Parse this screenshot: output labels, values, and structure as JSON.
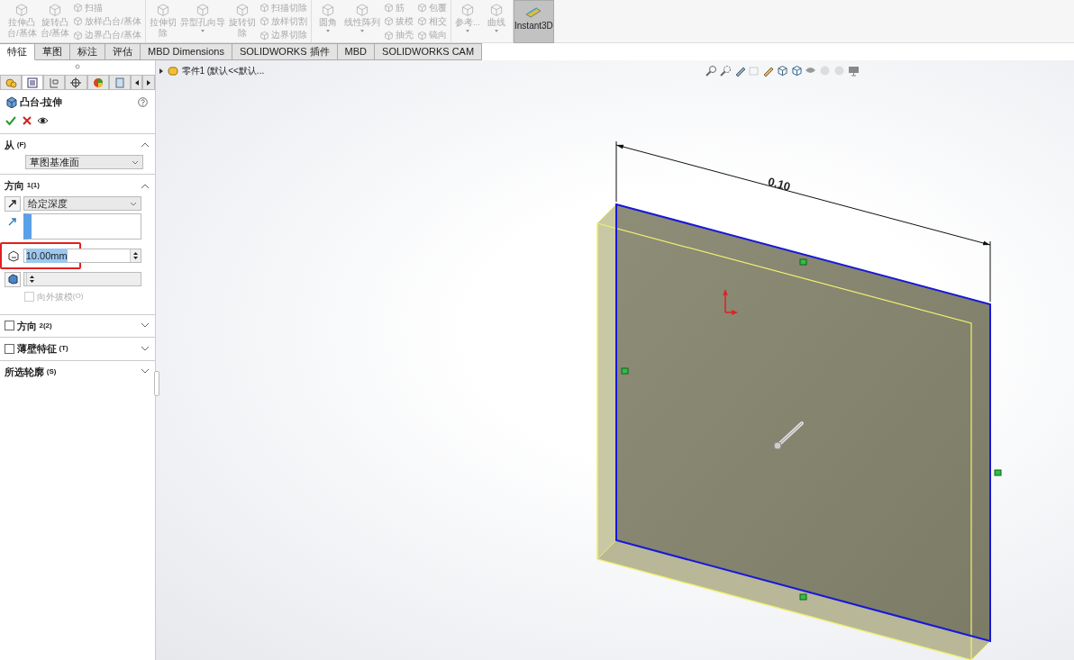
{
  "toolbar": {
    "groups": [
      {
        "items": [
          {
            "kind": "big",
            "lines": [
              "拉伸凸",
              "台/基体"
            ],
            "disabled": true,
            "dropdown": false
          },
          {
            "kind": "big",
            "lines": [
              "旋转凸",
              "台/基体"
            ],
            "disabled": true,
            "dropdown": false
          },
          {
            "kind": "stack",
            "entries": [
              {
                "label": "扫描",
                "disabled": true
              },
              {
                "label": "放样凸台/基体",
                "disabled": true
              },
              {
                "label": "边界凸台/基体",
                "disabled": true
              }
            ]
          }
        ]
      },
      {
        "items": [
          {
            "kind": "big",
            "lines": [
              "拉伸切",
              "除"
            ],
            "disabled": true,
            "dropdown": false
          },
          {
            "kind": "big",
            "lines": [
              "异型孔向导"
            ],
            "disabled": true,
            "dropdown": true
          },
          {
            "kind": "big",
            "lines": [
              "旋转切",
              "除"
            ],
            "disabled": true,
            "dropdown": false
          },
          {
            "kind": "stack",
            "entries": [
              {
                "label": "扫描切除",
                "disabled": true
              },
              {
                "label": "放样切割",
                "disabled": true
              },
              {
                "label": "边界切除",
                "disabled": true
              }
            ]
          }
        ]
      },
      {
        "items": [
          {
            "kind": "big",
            "lines": [
              "圆角"
            ],
            "disabled": true,
            "dropdown": true
          },
          {
            "kind": "big",
            "lines": [
              "线性阵列"
            ],
            "disabled": true,
            "dropdown": true
          },
          {
            "kind": "stack",
            "entries": [
              {
                "label": "筋",
                "disabled": true
              },
              {
                "label": "拔模",
                "disabled": true
              },
              {
                "label": "抽壳",
                "disabled": true
              }
            ]
          },
          {
            "kind": "stack",
            "entries": [
              {
                "label": "包覆",
                "disabled": true
              },
              {
                "label": "相交",
                "disabled": true
              },
              {
                "label": "镜向",
                "disabled": true
              }
            ]
          }
        ]
      },
      {
        "items": [
          {
            "kind": "big",
            "lines": [
              "参考..."
            ],
            "disabled": true,
            "dropdown": true
          },
          {
            "kind": "big",
            "lines": [
              "曲线"
            ],
            "disabled": true,
            "dropdown": true
          }
        ]
      }
    ],
    "instant3d": {
      "label": "Instant3D",
      "on": true
    }
  },
  "tabs": [
    {
      "label": "特征",
      "selected": true
    },
    {
      "label": "草图",
      "selected": false
    },
    {
      "label": "标注",
      "selected": false
    },
    {
      "label": "评估",
      "selected": false
    },
    {
      "label": "MBD Dimensions",
      "selected": false
    },
    {
      "label": "SOLIDWORKS 插件",
      "selected": false
    },
    {
      "label": "MBD",
      "selected": false
    },
    {
      "label": "SOLIDWORKS CAM",
      "selected": false
    }
  ],
  "panel_tabs": [
    {
      "kind": "tree",
      "selected": false
    },
    {
      "kind": "property",
      "selected": true
    },
    {
      "kind": "config",
      "selected": false
    },
    {
      "kind": "target",
      "selected": false
    },
    {
      "kind": "display",
      "selected": false
    },
    {
      "kind": "more",
      "selected": false
    }
  ],
  "feature": {
    "title": "凸台-拉伸"
  },
  "sections": [
    {
      "kind": "from",
      "label": "从",
      "shortcut": "(F)",
      "expanded": true,
      "select": "草图基准面"
    },
    {
      "kind": "direction",
      "label": "方向",
      "shortcut": "1(1)",
      "expanded": true,
      "end_condition": "给定深度",
      "depth": {
        "value": "10.00mm",
        "selected": true,
        "highlighted": true
      },
      "draft": {
        "label": "向外拔模",
        "shortcut": "(O)",
        "checked": false,
        "disabled": true
      }
    },
    {
      "kind": "check",
      "label": "方向",
      "shortcut": "2(2)",
      "checked": false,
      "expanded": false
    },
    {
      "kind": "check",
      "label": "薄壁特征",
      "shortcut": "(T)",
      "checked": false,
      "expanded": false
    },
    {
      "kind": "plain",
      "label": "所选轮廓",
      "shortcut": "(S)",
      "expanded": false
    }
  ],
  "tree": {
    "label": "零件1 (默认<<默认...",
    "expanded": false
  },
  "model": {
    "dimension": "0.10"
  }
}
